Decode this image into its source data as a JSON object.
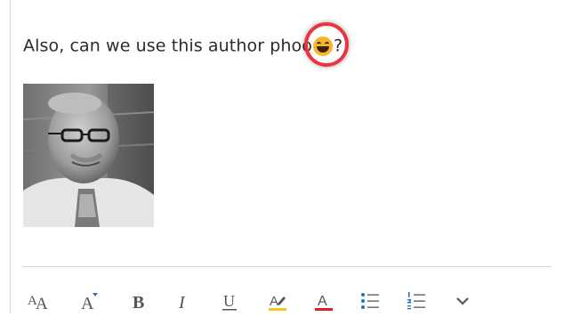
{
  "message": {
    "text_before_emoji": "Also, can we use this author pho",
    "text_inside_ring": "o",
    "text_after_emoji": "?"
  },
  "emoji_icon": "grinning-face-emoji",
  "colors": {
    "highlight_ring": "#ea3440",
    "highlighter_yellow": "#f5c518",
    "font_color_red": "#e02020",
    "list_bullet_blue": "#2b6cc4",
    "icon_gray": "#555555"
  },
  "toolbar": {
    "items": [
      {
        "name": "font-size-icon"
      },
      {
        "name": "grow-font-icon"
      },
      {
        "name": "bold-icon"
      },
      {
        "name": "italic-icon"
      },
      {
        "name": "underline-icon"
      },
      {
        "name": "highlight-icon"
      },
      {
        "name": "font-color-icon"
      },
      {
        "name": "bulleted-list-icon"
      },
      {
        "name": "numbered-list-icon"
      },
      {
        "name": "more-options-chevron-icon"
      }
    ]
  }
}
